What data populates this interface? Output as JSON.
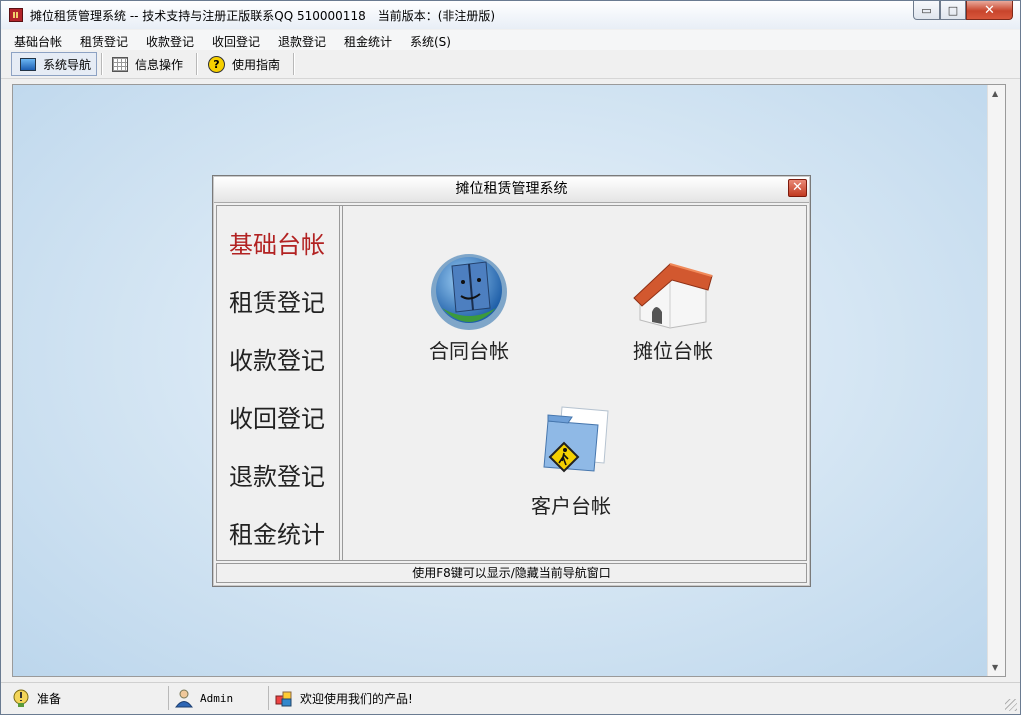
{
  "window": {
    "title": "摊位租赁管理系统 -- 技术支持与注册正版联系QQ 510000118　当前版本：(非注册版)",
    "min_glyph": "▭",
    "max_glyph": "□",
    "close_glyph": "✕"
  },
  "menubar": {
    "items": [
      "基础台帐",
      "租赁登记",
      "收款登记",
      "收回登记",
      "退款登记",
      "租金统计",
      "系统(S)"
    ]
  },
  "toolbar": {
    "items": [
      {
        "label": "系统导航",
        "icon": "monitor-icon",
        "active": true
      },
      {
        "label": "信息操作",
        "icon": "grid-icon",
        "active": false
      },
      {
        "label": "使用指南",
        "icon": "help-icon",
        "active": false
      }
    ],
    "help_glyph": "?"
  },
  "dialog": {
    "title": "摊位租赁管理系统",
    "close_glyph": "✕",
    "sidebar": [
      "基础台帐",
      "租赁登记",
      "收款登记",
      "收回登记",
      "退款登记",
      "租金统计"
    ],
    "active_index": 0,
    "features": [
      {
        "label": "合同台帐",
        "icon": "finder-face-icon"
      },
      {
        "label": "摊位台帐",
        "icon": "house-icon"
      },
      {
        "label": "客户台帐",
        "icon": "folder-pedestrian-icon"
      }
    ],
    "hint": "使用F8键可以显示/隐藏当前导航窗口"
  },
  "statusbar": {
    "ready": "准备",
    "user": "Admin",
    "message": "欢迎使用我们的产品!"
  },
  "colors": {
    "active_sidebar": "#b22222",
    "desktop_bg": "#cfe2f2",
    "close_red": "#c8452c"
  }
}
